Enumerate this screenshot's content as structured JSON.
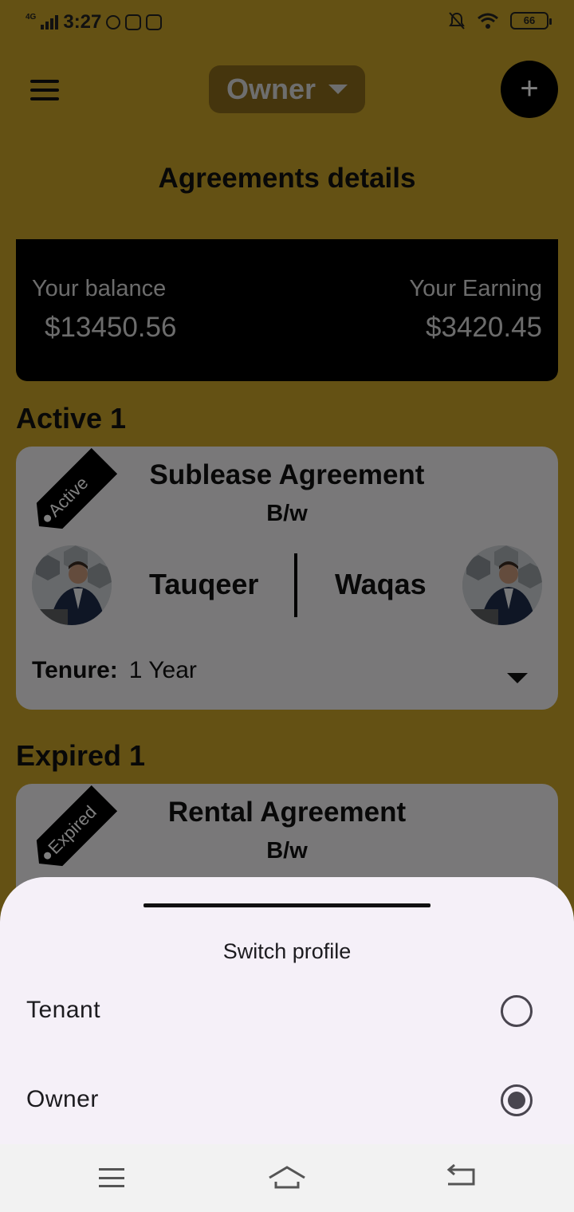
{
  "status_bar": {
    "network": "4G",
    "time": "3:27",
    "battery": "66"
  },
  "appbar": {
    "profile_selected": "Owner",
    "add_label": "+"
  },
  "page": {
    "title": "Agreements details"
  },
  "balance": {
    "balance_label": "Your balance",
    "balance_value": "$13450.56",
    "earning_label": "Your Earning",
    "earning_value": "$3420.45"
  },
  "active_section": {
    "label": "Active 1",
    "card": {
      "tag": "Active",
      "title": "Sublease Agreement",
      "between": "B/w",
      "party_left": "Tauqeer",
      "party_right": "Waqas",
      "tenure_label": "Tenure:",
      "tenure_value": "1 Year"
    }
  },
  "expired_section": {
    "label": "Expired 1",
    "card": {
      "tag": "Expired",
      "title": "Rental Agreement",
      "between": "B/w"
    }
  },
  "sheet": {
    "title": "Switch profile",
    "options": [
      {
        "label": "Tenant",
        "selected": false
      },
      {
        "label": "Owner",
        "selected": true
      }
    ]
  },
  "colors": {
    "screen_background": "#c9a328",
    "card_background": "#f3f0f3",
    "sheet_background": "#f5f0f8",
    "accent_dark": "#000000"
  }
}
